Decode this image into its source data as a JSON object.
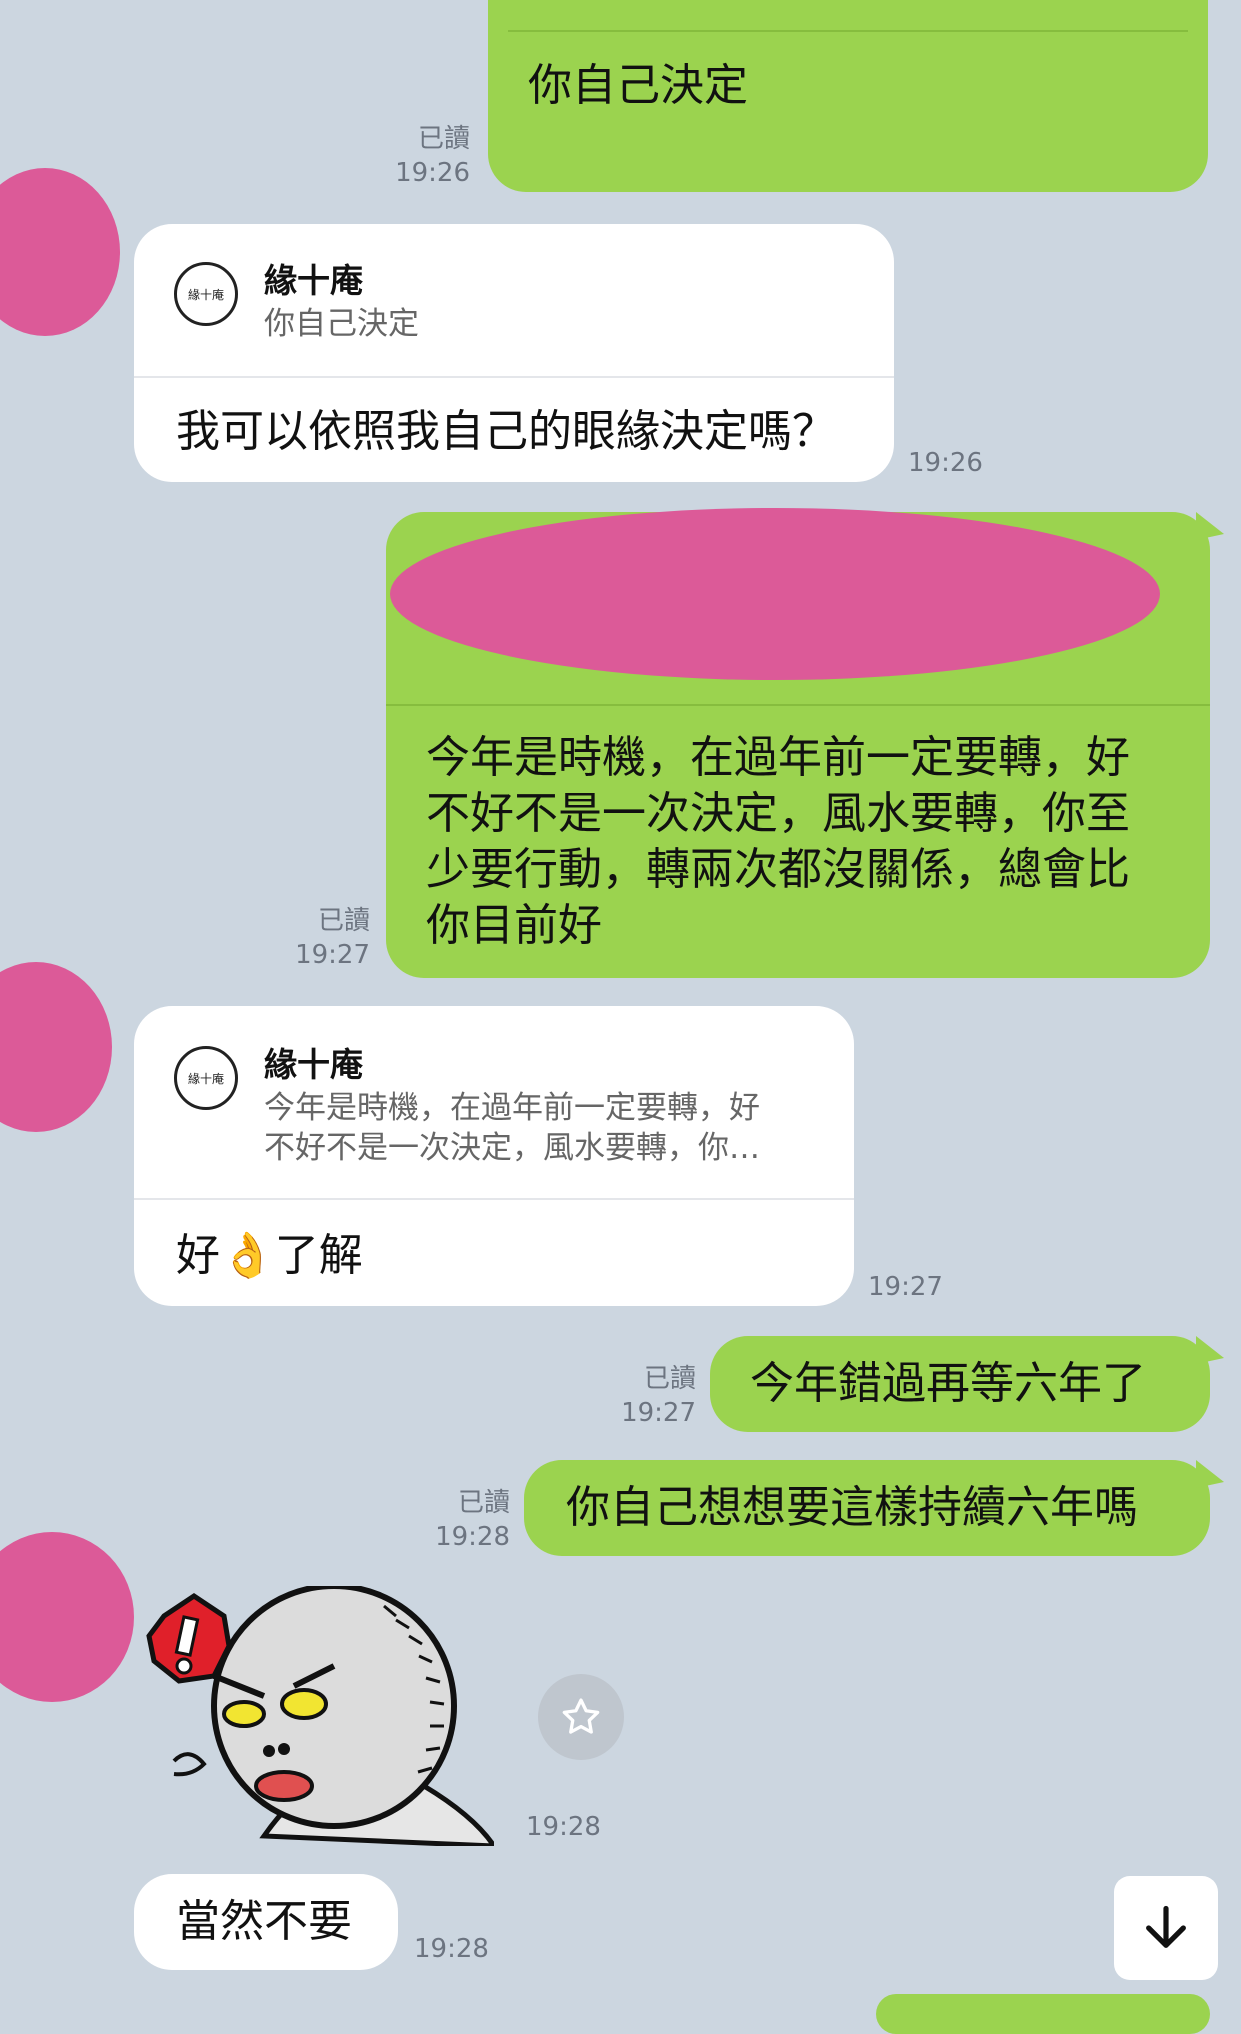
{
  "messages": {
    "m1": {
      "text": "你自己決定",
      "read": "已讀",
      "time": "19:26"
    },
    "m2": {
      "reply_name": "緣十庵",
      "reply_quote": "你自己決定",
      "text": "我可以依照我自己的眼緣決定嗎？",
      "time": "19:26"
    },
    "m3": {
      "text": "今年是時機，在過年前一定要轉，好不好不是一次決定，風水要轉，你至少要行動，轉兩次都沒關係，總會比你目前好",
      "read": "已讀",
      "time": "19:27"
    },
    "m4": {
      "reply_name": "緣十庵",
      "reply_quote_line1": "今年是時機，在過年前一定要轉，好",
      "reply_quote_line2": "不好不是一次決定，風水要轉，你…",
      "text": "好👌了解",
      "time": "19:27"
    },
    "m5": {
      "text": "今年錯過再等六年了",
      "read": "已讀",
      "time": "19:27"
    },
    "m6": {
      "text": "你自己想想要這樣持續六年嗎",
      "read": "已讀",
      "time": "19:28"
    },
    "m7": {
      "sticker": "angry-round-character-sticker",
      "time": "19:28"
    },
    "m8": {
      "text": "當然不要",
      "time": "19:28"
    }
  },
  "seal": {
    "text": "緣十庵"
  },
  "colors": {
    "background": "#ccd6e0",
    "sent_bubble": "#9bd34f",
    "received_bubble": "#ffffff",
    "avatar_redaction": "#dc5a98"
  },
  "icons": {
    "star": "star-icon",
    "scroll_down": "arrow-down-icon"
  }
}
